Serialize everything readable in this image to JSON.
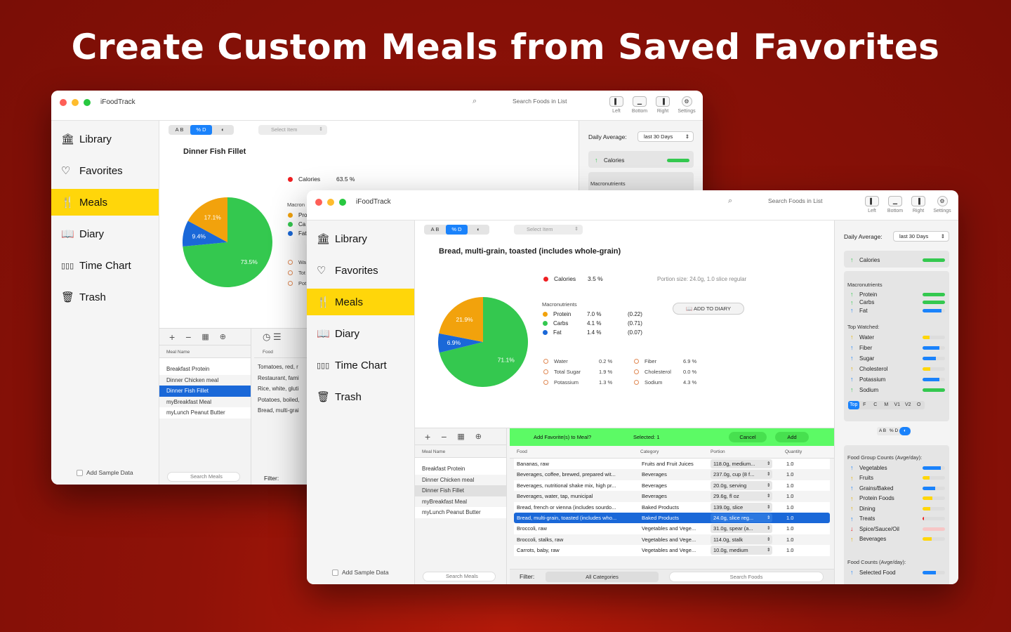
{
  "headline": "Create Custom Meals from Saved Favorites",
  "app": {
    "title": "iFoodTrack",
    "search_placeholder": "Search Foods in List",
    "toolbar": [
      "Left",
      "Bottom",
      "Right",
      "Settings"
    ]
  },
  "sidebar": {
    "items": [
      "Library",
      "Favorites",
      "Meals",
      "Diary",
      "Time Chart",
      "Trash"
    ],
    "active": "Meals",
    "add_sample": "Add Sample Data"
  },
  "seg": [
    "A B",
    "% D",
    "◐"
  ],
  "select_item": "Select Item",
  "back": {
    "food_title": "Dinner Fish Fillet",
    "calories_label": "Calories",
    "calories_pct": "63.5 %",
    "macros_cut": [
      "Pro",
      "Ca",
      "Fat"
    ],
    "macro_hdr_cut": "Macron",
    "nut_cut": [
      "Wa",
      "Tot",
      "Pot"
    ],
    "pie": [
      {
        "label": "73.5%",
        "value": 73.5,
        "color": "#34c84f"
      },
      {
        "label": "9.4%",
        "value": 9.4,
        "color": "#1a68d8"
      },
      {
        "label": "17.1%",
        "value": 17.1,
        "color": "#f2a20c"
      }
    ],
    "food_hdr": "Food",
    "foods_cut": [
      "Tomatoes, red, r",
      "Restaurant, fami",
      "Rice, white, gluti",
      "Potatoes, boiled,",
      "Bread, multi-grai"
    ],
    "filter_label": "Filter:",
    "daily_calories": "Calories",
    "macronutrients": "Macronutrients"
  },
  "front": {
    "food_title": "Bread, multi-grain, toasted (includes whole-grain)",
    "calories_label": "Calories",
    "calories_pct": "3.5 %",
    "portion": "Portion size: 24.0g, 1.0 slice regular",
    "add_diary": "ADD TO DIARY",
    "macro_hdr": "Macronutrients",
    "macros": [
      {
        "name": "Protein",
        "pct": "7.0 %",
        "g": "(0.22)",
        "color": "#f2a20c"
      },
      {
        "name": "Carbs",
        "pct": "4.1 %",
        "g": "(0.71)",
        "color": "#34c84f"
      },
      {
        "name": "Fat",
        "pct": "1.4 %",
        "g": "(0.07)",
        "color": "#1a68d8"
      }
    ],
    "nutrients_left": [
      {
        "name": "Water",
        "pct": "0.2 %"
      },
      {
        "name": "Total Sugar",
        "pct": "1.9 %"
      },
      {
        "name": "Potassium",
        "pct": "1.3 %"
      }
    ],
    "nutrients_right": [
      {
        "name": "Fiber",
        "pct": "6.9 %"
      },
      {
        "name": "Cholesterol",
        "pct": "0.0 %"
      },
      {
        "name": "Sodium",
        "pct": "4.3 %"
      }
    ],
    "pie": [
      {
        "label": "71.1%",
        "value": 71.1,
        "color": "#34c84f"
      },
      {
        "label": "6.9%",
        "value": 6.9,
        "color": "#1a68d8"
      },
      {
        "label": "21.9%",
        "value": 21.9,
        "color": "#f2a20c"
      }
    ]
  },
  "meals": {
    "header": "Meal Name",
    "rows": [
      "Breakfast Protein",
      "Dinner Chicken meal",
      "Dinner Fish Fillet",
      "myBreakfast Meal",
      "myLunch Peanut Butter"
    ],
    "selected": "Dinner Fish Fillet",
    "search": "Search Meals"
  },
  "add_bar": {
    "prompt": "Add Favorite(s) to Meal?",
    "selected": "Selected: 1",
    "cancel": "Cancel",
    "add": "Add"
  },
  "food_table": {
    "headers": [
      "Food",
      "Category",
      "Portion",
      "Quantity"
    ],
    "rows": [
      {
        "food": "Bananas, raw",
        "category": "Fruits and Fruit Juices",
        "portion": "118.0g, medium...",
        "qty": "1.0"
      },
      {
        "food": "Beverages, coffee, brewed, prepared wit...",
        "category": "Beverages",
        "portion": "237.0g, cup (8 f...",
        "qty": "1.0"
      },
      {
        "food": "Beverages, nutritional shake mix, high pr...",
        "category": "Beverages",
        "portion": "20.0g, serving",
        "qty": "1.0"
      },
      {
        "food": "Beverages, water, tap, municipal",
        "category": "Beverages",
        "portion": "29.6g, fl oz",
        "qty": "1.0"
      },
      {
        "food": "Bread, french or vienna (includes sourdo...",
        "category": "Baked Products",
        "portion": "139.0g, slice",
        "qty": "1.0"
      },
      {
        "food": "Bread, multi-grain, toasted (includes who...",
        "category": "Baked Products",
        "portion": "24.0g, slice reg...",
        "qty": "1.0",
        "selected": true
      },
      {
        "food": "Broccoli, raw",
        "category": "Vegetables and Vege...",
        "portion": "31.0g, spear (a...",
        "qty": "1.0"
      },
      {
        "food": "Broccoli, stalks, raw",
        "category": "Vegetables and Vege...",
        "portion": "114.0g, stalk",
        "qty": "1.0"
      },
      {
        "food": "Carrots, baby, raw",
        "category": "Vegetables and Vege...",
        "portion": "10.0g, medium",
        "qty": "1.0"
      }
    ],
    "filter_label": "Filter:",
    "filter_value": "All Categories",
    "search": "Search Foods"
  },
  "right": {
    "daily_label": "Daily Average:",
    "period": "last 30 Days",
    "calories": "Calories",
    "macro_title": "Macronutrients",
    "macros": [
      {
        "name": "Protein",
        "level": 1.0,
        "color": "#34c84f",
        "dir": "up"
      },
      {
        "name": "Carbs",
        "level": 1.0,
        "color": "#34c84f",
        "dir": "up"
      },
      {
        "name": "Fat",
        "level": 0.85,
        "color": "#1a82fb",
        "dir": "up"
      }
    ],
    "top_title": "Top Watched:",
    "top": [
      {
        "name": "Water",
        "level": 0.3,
        "color": "#ffd60a",
        "dir": "up"
      },
      {
        "name": "Fiber",
        "level": 0.75,
        "color": "#1a82fb",
        "dir": "up"
      },
      {
        "name": "Sugar",
        "level": 0.6,
        "color": "#1a82fb",
        "dir": "up"
      },
      {
        "name": "Cholesterol",
        "level": 0.35,
        "color": "#ffd60a",
        "dir": "up"
      },
      {
        "name": "Potassium",
        "level": 0.75,
        "color": "#1a82fb",
        "dir": "up"
      },
      {
        "name": "Sodium",
        "level": 1.0,
        "color": "#34c84f",
        "dir": "up"
      }
    ],
    "tabs": [
      "Top",
      "F",
      "C",
      "M",
      "V1",
      "V2",
      "O"
    ],
    "seg2": [
      "A B",
      "% D",
      "◐"
    ],
    "group_title": "Food Group Counts (Avge/day):",
    "groups": [
      {
        "name": "Vegetables",
        "level": 0.8,
        "color": "#1a82fb",
        "dir": "up"
      },
      {
        "name": "Fruits",
        "level": 0.3,
        "color": "#ffd60a",
        "dir": "up"
      },
      {
        "name": "Grains/Baked",
        "level": 0.55,
        "color": "#1a82fb",
        "dir": "up"
      },
      {
        "name": "Protein Foods",
        "level": 0.45,
        "color": "#ffd60a",
        "dir": "up"
      },
      {
        "name": "Dining",
        "level": 0.35,
        "color": "#ffd60a",
        "dir": "up"
      },
      {
        "name": "Treats",
        "level": 0.05,
        "color": "#ef1f22",
        "dir": "up"
      },
      {
        "name": "Spice/Sauce/Oil",
        "level": 0.0,
        "color": "#ef1f22",
        "dir": "down"
      },
      {
        "name": "Beverages",
        "level": 0.4,
        "color": "#ffd60a",
        "dir": "up"
      }
    ],
    "count_title": "Food Counts (Avge/day):",
    "selected_food": "Selected Food"
  }
}
